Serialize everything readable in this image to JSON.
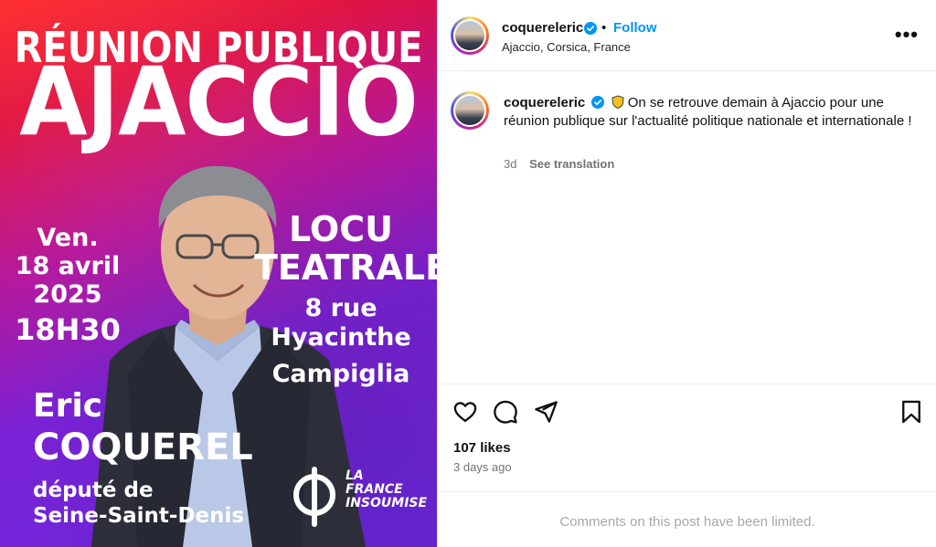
{
  "poster": {
    "title_line1": "RÉUNION PUBLIQUE",
    "title_line2": "AJACCIO",
    "date_day": "Ven.",
    "date_date": "18 avril",
    "date_year": "2025",
    "date_time": "18H30",
    "venue_line1": "LOCU",
    "venue_line2": "TEATRALE",
    "address_line1": "8 rue Hyacinthe",
    "address_line2": "Campiglia",
    "person_first": "Eric",
    "person_last": "COQUEREL",
    "role_line1": "député de",
    "role_line2": "Seine-Saint-Denis",
    "logo_line1": "LA",
    "logo_line2": "FRANCE",
    "logo_line3": "INSOUMISE",
    "colors": {
      "top": "#ff2a2a",
      "bottom": "#6a27e0"
    }
  },
  "header": {
    "username": "coquereleric",
    "separator": "•",
    "follow_label": "Follow",
    "location": "Ajaccio, Corsica, France",
    "more_icon": "more-horizontal-icon",
    "accent": "#0095f6"
  },
  "caption": {
    "username": "coquereleric",
    "text": "On se retrouve demain à Ajaccio pour une réunion publique sur l'actualité politique nationale et internationale !",
    "time": "3d",
    "see_translation": "See translation"
  },
  "actions": {
    "icons": [
      "heart-icon",
      "comment-icon",
      "share-icon",
      "bookmark-icon"
    ],
    "likes": "107 likes",
    "posted_ago": "3 days ago"
  },
  "footer": {
    "limited": "Comments on this post have been limited."
  }
}
